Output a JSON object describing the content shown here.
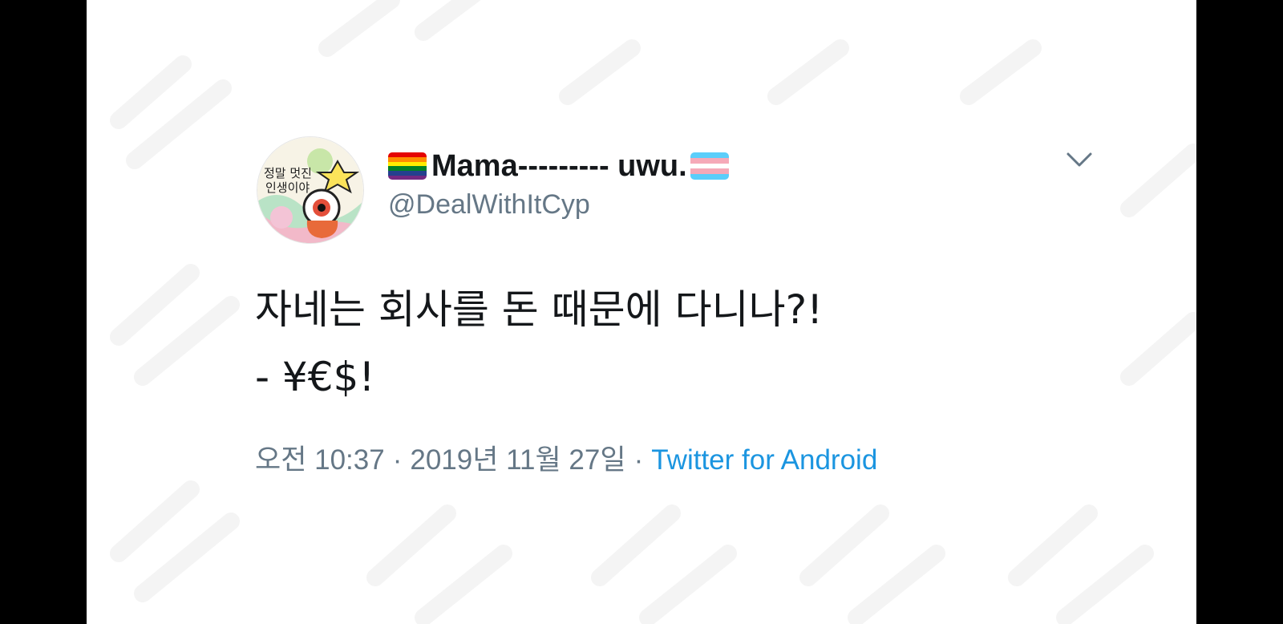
{
  "tweet": {
    "display_name": "Mama--------- uwu.",
    "handle": "@DealWithItCyp",
    "text_line1": "자네는 회사를 돈 때문에 다니나?!",
    "text_line2": "- ¥€$!",
    "time": "오전 10:37",
    "separator": "·",
    "date": "2019년 11월 27일",
    "source": "Twitter for Android",
    "avatar_text_line1": "정말 멋진",
    "avatar_text_line2": "인생이야"
  },
  "icons": {
    "leading_flag": "rainbow-flag-icon",
    "trailing_flag": "transgender-flag-icon",
    "menu": "chevron-down-icon"
  },
  "colors": {
    "name": "#14171a",
    "secondary_text": "#657786",
    "link": "#1b95e0",
    "background": "#ffffff"
  }
}
